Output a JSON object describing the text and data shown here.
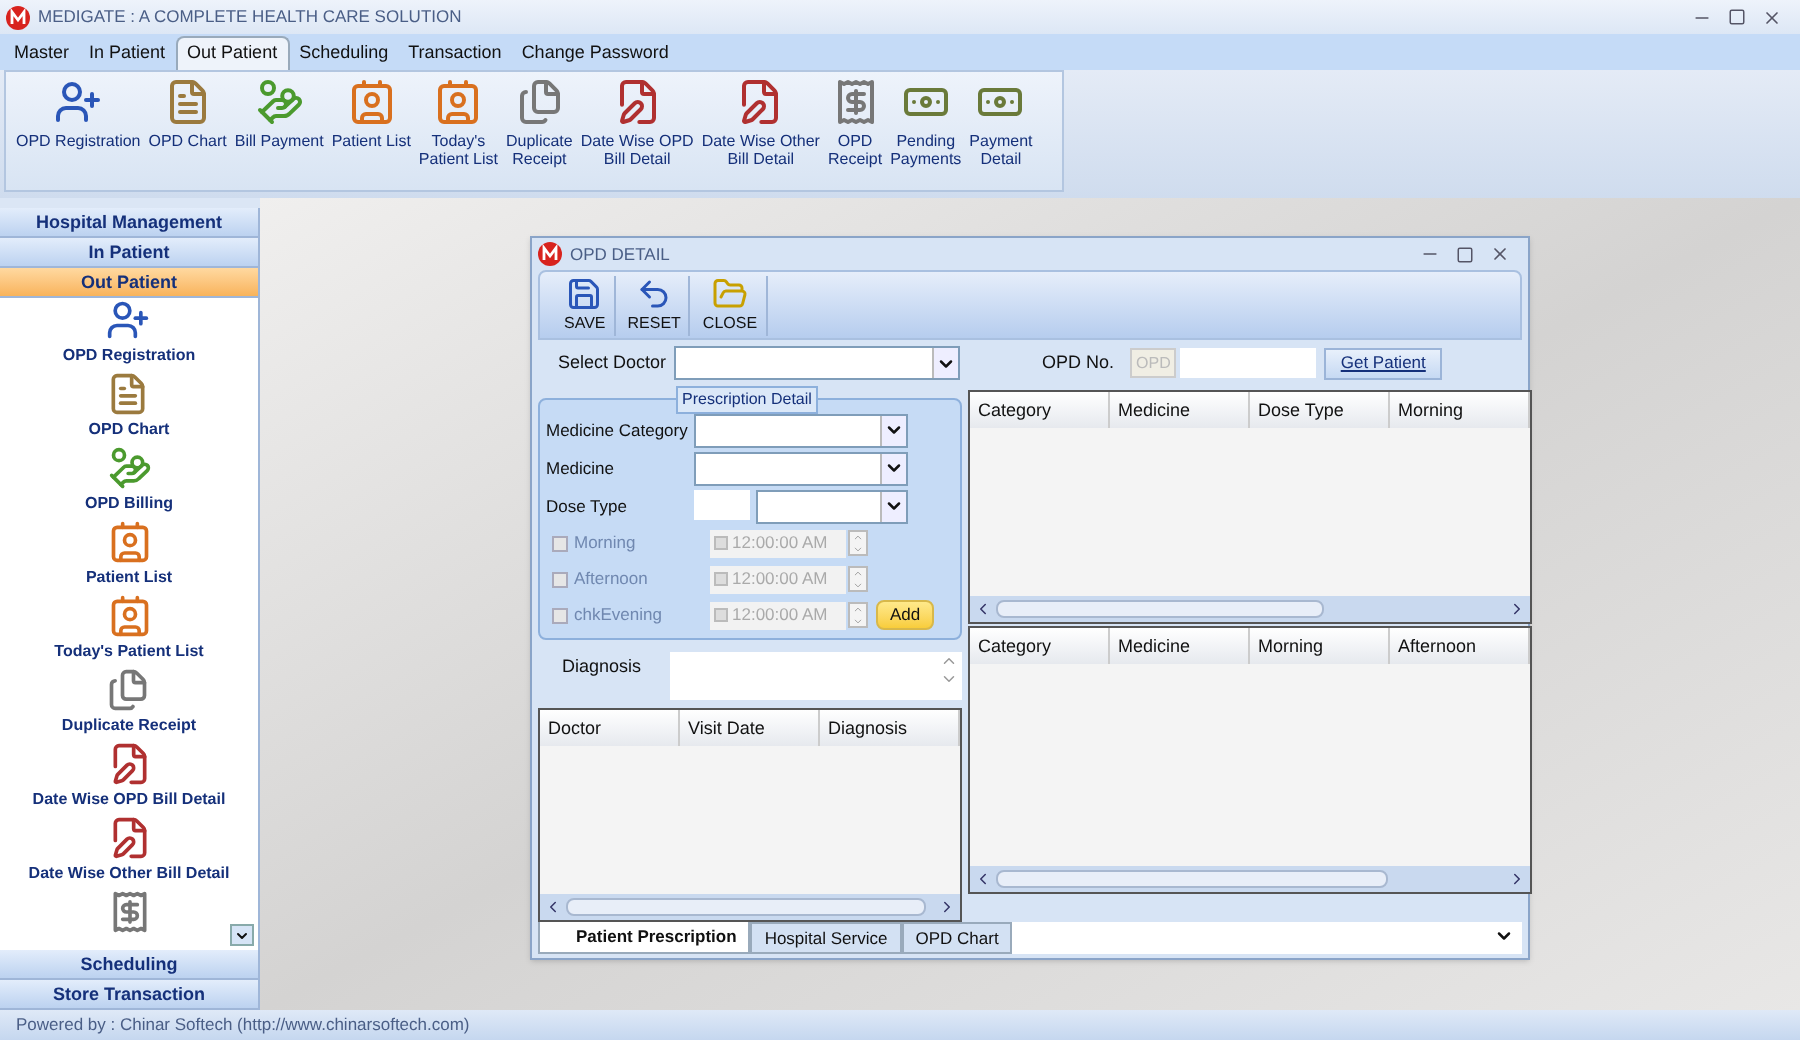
{
  "window": {
    "title": "MEDIGATE : A COMPLETE HEALTH CARE SOLUTION"
  },
  "menu_tabs": [
    {
      "label": "Master",
      "selected": false
    },
    {
      "label": "In Patient",
      "selected": false
    },
    {
      "label": "Out Patient",
      "selected": true
    },
    {
      "label": "Scheduling",
      "selected": false
    },
    {
      "label": "Transaction",
      "selected": false
    },
    {
      "label": "Change Password",
      "selected": false
    }
  ],
  "ribbon": [
    {
      "label": "OPD Registration"
    },
    {
      "label": "OPD Chart"
    },
    {
      "label": "Bill Payment"
    },
    {
      "label": "Patient List"
    },
    {
      "label": "Today's\nPatient List"
    },
    {
      "label": "Duplicate\nReceipt"
    },
    {
      "label": "Date Wise OPD\nBill Detail"
    },
    {
      "label": "Date Wise Other\nBill Detail"
    },
    {
      "label": "OPD\nReceipt"
    },
    {
      "label": "Pending\nPayments"
    },
    {
      "label": "Payment\nDetail"
    }
  ],
  "sidebar": {
    "sections_top": [
      {
        "label": "Hospital Management",
        "selected": false
      },
      {
        "label": "In Patient",
        "selected": false
      },
      {
        "label": "Out Patient",
        "selected": true
      }
    ],
    "items": [
      {
        "label": "OPD Registration"
      },
      {
        "label": "OPD Chart"
      },
      {
        "label": "OPD Billing"
      },
      {
        "label": "Patient List"
      },
      {
        "label": "Today's Patient List"
      },
      {
        "label": "Duplicate Receipt"
      },
      {
        "label": "Date Wise OPD Bill Detail"
      },
      {
        "label": "Date Wise Other Bill Detail"
      }
    ],
    "sections_bottom": [
      {
        "label": "Scheduling",
        "selected": false
      },
      {
        "label": "Store Transaction",
        "selected": false
      }
    ]
  },
  "dialog": {
    "title": "OPD DETAIL",
    "toolbar": [
      {
        "label": "SAVE"
      },
      {
        "label": "RESET"
      },
      {
        "label": "CLOSE"
      }
    ],
    "select_doctor": {
      "label": "Select Doctor"
    },
    "opd_no": {
      "label": "OPD No.",
      "prefix": "OPD",
      "prefix_disabled": true,
      "button": "Get Patient"
    },
    "prescription": {
      "title": "Prescription Detail",
      "fields": [
        {
          "label": "Medicine Category"
        },
        {
          "label": "Medicine"
        },
        {
          "label": "Dose Type"
        }
      ],
      "times": [
        {
          "label": "Morning",
          "checked": false,
          "disabled": true,
          "time": "12:00:00 AM"
        },
        {
          "label": "Afternoon",
          "checked": false,
          "disabled": true,
          "time": "12:00:00 AM"
        },
        {
          "label": "chkEvening",
          "checked": false,
          "disabled": true,
          "time": "12:00:00 AM"
        }
      ],
      "add_button": "Add"
    },
    "diagnosis": {
      "label": "Diagnosis"
    },
    "history_table": {
      "columns": [
        "Doctor",
        "Visit Date",
        "Diagnosis"
      ]
    },
    "medicine_table": {
      "columns": [
        "Category",
        "Medicine",
        "Dose Type",
        "Morning"
      ]
    },
    "schedule_table": {
      "columns": [
        "Category",
        "Medicine",
        "Morning",
        "Afternoon"
      ]
    },
    "tabs": [
      {
        "label": "Patient Prescription",
        "selected": true
      },
      {
        "label": "Hospital Service",
        "selected": false
      },
      {
        "label": "OPD Chart",
        "selected": false
      }
    ]
  },
  "status_bar": "Powered by : Chinar Softech (http://www.chinarsoftech.com)"
}
